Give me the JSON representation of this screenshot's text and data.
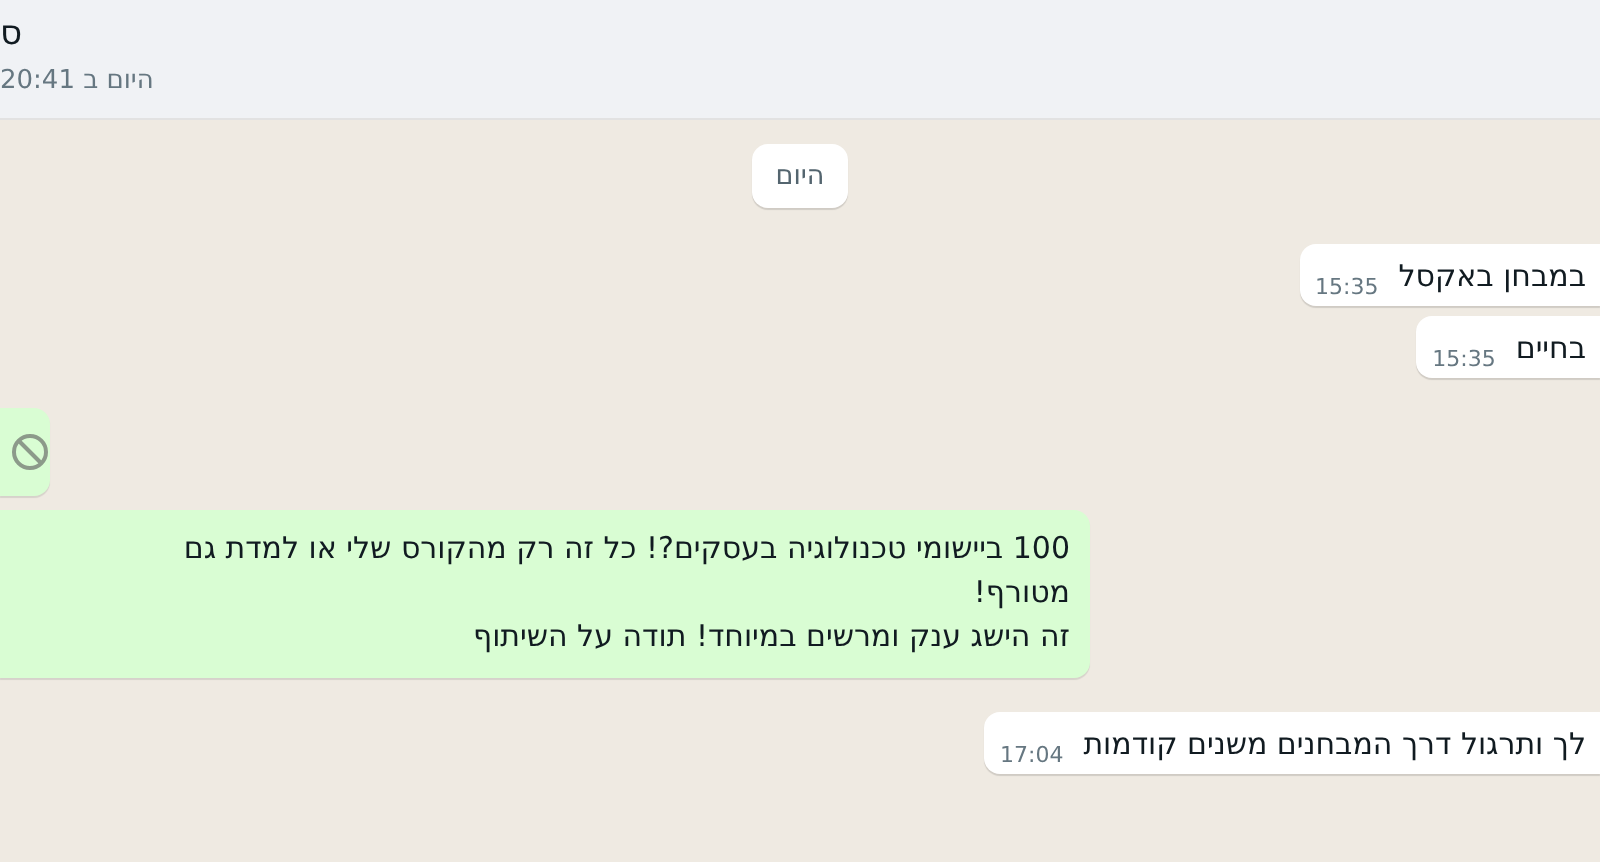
{
  "header": {
    "name": "ס",
    "status": "היום ב 20:41"
  },
  "day_chip": "היום",
  "messages": [
    {
      "kind": "incoming",
      "text": "במבחן באקסל",
      "time": "15:35"
    },
    {
      "kind": "incoming",
      "text": "בחיים",
      "time": "15:35"
    },
    {
      "kind": "deleted"
    },
    {
      "kind": "outgoing",
      "lines": [
        "100 ביישומי טכנולוגיה בעסקים?! כל זה רק מהקורס שלי או למדת גם",
        "מטורף!",
        "זה הישג ענק ומרשים במיוחד! תודה על השיתוף"
      ]
    },
    {
      "kind": "incoming",
      "text": "לך ותרגול דרך המבחנים משנים קודמות",
      "time": "17:04"
    }
  ]
}
